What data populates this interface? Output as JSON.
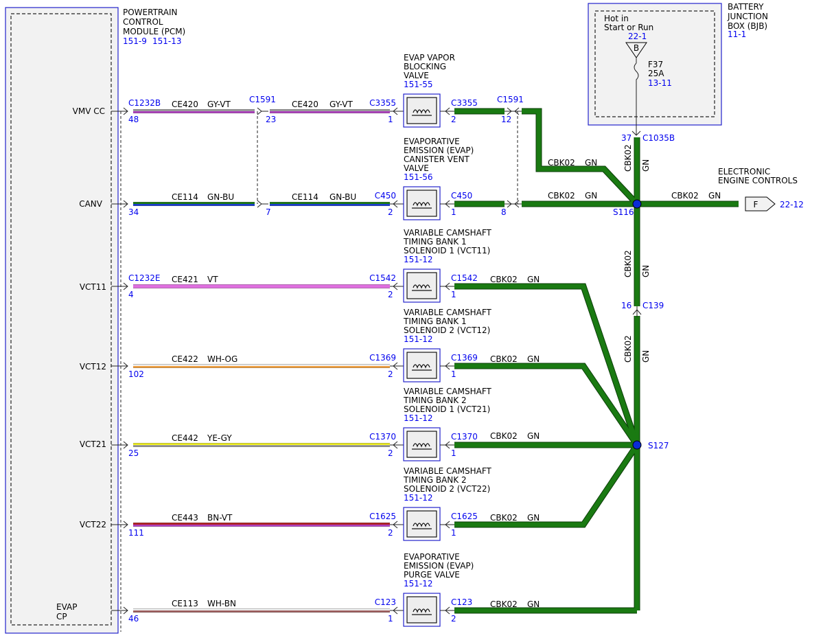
{
  "pcm": {
    "title_lines": [
      "POWERTRAIN",
      "CONTROL",
      "MODULE (PCM)"
    ],
    "refs": [
      "151-9",
      "151-13"
    ],
    "pins": [
      {
        "label": "VMV CC"
      },
      {
        "label": "CANV"
      },
      {
        "label": "VCT11"
      },
      {
        "label": "VCT12"
      },
      {
        "label": "VCT21"
      },
      {
        "label": "VCT22"
      },
      {
        "label": "EVAP"
      },
      {
        "label": "CP"
      }
    ]
  },
  "bjb": {
    "title_lines": [
      "BATTERY",
      "JUNCTION",
      "BOX (BJB)"
    ],
    "ref": "11-1",
    "hot_lines": [
      "Hot in",
      "Start or Run"
    ],
    "hot_ref": "22-1",
    "triangle_letter": "B",
    "fuse": "F37",
    "fuse_amps": "25A",
    "fuse_ref": "13-11",
    "pin": "37",
    "connector": "C1035B"
  },
  "components": [
    {
      "lines": [
        "EVAP VAPOR",
        "BLOCKING",
        "VALVE"
      ],
      "ref": "151-55"
    },
    {
      "lines": [
        "EVAPORATIVE",
        "EMISSION (EVAP)",
        "CANISTER VENT",
        "VALVE"
      ],
      "ref": "151-56"
    },
    {
      "lines": [
        "VARIABLE CAMSHAFT",
        "TIMING BANK 1",
        "SOLENOID 1 (VCT11)"
      ],
      "ref": "151-12"
    },
    {
      "lines": [
        "VARIABLE CAMSHAFT",
        "TIMING BANK 1",
        "SOLENOID 2 (VCT12)"
      ],
      "ref": "151-12"
    },
    {
      "lines": [
        "VARIABLE CAMSHAFT",
        "TIMING BANK 2",
        "SOLENOID 1 (VCT21)"
      ],
      "ref": "151-12"
    },
    {
      "lines": [
        "VARIABLE CAMSHAFT",
        "TIMING BANK 2",
        "SOLENOID 2 (VCT22)"
      ],
      "ref": "151-12"
    },
    {
      "lines": [
        "EVAPORATIVE",
        "EMISSION (EVAP)",
        "PURGE VALVE"
      ],
      "ref": "151-12"
    }
  ],
  "circuits": [
    {
      "pcm_conn": "C1232B",
      "pcm_pin": "48",
      "name": "CE420",
      "color_label": "GY-VT",
      "mid_conn": "C1591",
      "mid_pin": "23",
      "name2": "CE420",
      "color_label2": "GY-VT",
      "comp_conn": "C3355",
      "comp_pin_in": "1",
      "out_conn": "C3355",
      "out_pin": "2",
      "out_mid_conn": "C1591",
      "out_mid_pin": "12",
      "colors": [
        "#9a9a9a",
        "#b040c0"
      ]
    },
    {
      "pcm_conn": "",
      "pcm_pin": "34",
      "name": "CE114",
      "color_label": "GN-BU",
      "mid_conn": "",
      "mid_pin": "7",
      "name2": "CE114",
      "color_label2": "GN-BU",
      "comp_conn": "C450",
      "comp_pin_in": "2",
      "out_conn": "C450",
      "out_pin": "1",
      "out_mid_conn": "",
      "out_mid_pin": "8",
      "colors": [
        "#1a7a12",
        "#1a3cd0"
      ]
    },
    {
      "pcm_conn": "C1232E",
      "pcm_pin": "4",
      "name": "CE421",
      "color_label": "VT",
      "comp_conn": "C1542",
      "comp_pin_in": "2",
      "out_conn": "C1542",
      "out_pin": "1",
      "colors": [
        "#e070e0",
        "#e070e0"
      ]
    },
    {
      "pcm_conn": "",
      "pcm_pin": "102",
      "name": "CE422",
      "color_label": "WH-OG",
      "comp_conn": "C1369",
      "comp_pin_in": "2",
      "out_conn": "C1369",
      "out_pin": "1",
      "colors": [
        "#f0f0f0",
        "#f0a040"
      ]
    },
    {
      "pcm_conn": "",
      "pcm_pin": "25",
      "name": "CE442",
      "color_label": "YE-GY",
      "comp_conn": "C1370",
      "comp_pin_in": "2",
      "out_conn": "C1370",
      "out_pin": "1",
      "colors": [
        "#f0f020",
        "#9a9a9a"
      ]
    },
    {
      "pcm_conn": "",
      "pcm_pin": "111",
      "name": "CE443",
      "color_label": "BN-VT",
      "comp_conn": "C1625",
      "comp_pin_in": "2",
      "out_conn": "C1625",
      "out_pin": "1",
      "colors": [
        "#b02020",
        "#b040c0"
      ]
    },
    {
      "pcm_conn": "",
      "pcm_pin": "46",
      "name": "CE113",
      "color_label": "WH-BN",
      "comp_conn": "C123",
      "comp_pin_in": "1",
      "out_conn": "C123",
      "out_pin": "2",
      "colors": [
        "#f0f0f0",
        "#a06060"
      ]
    }
  ],
  "ground": {
    "wire": "CBK02",
    "color": "GN",
    "splice1": "S116",
    "splice2": "S127",
    "inline_pin": "16",
    "inline_conn": "C139",
    "eec_lines": [
      "ELECTRONIC",
      "ENGINE CONTROLS"
    ],
    "eec_letter": "F",
    "eec_ref": "22-12"
  }
}
